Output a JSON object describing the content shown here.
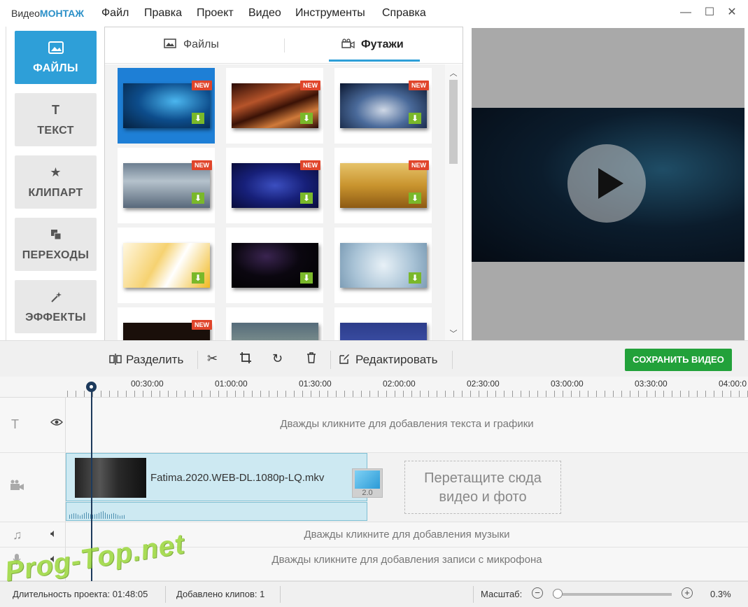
{
  "app": {
    "logo_part1": "Видео",
    "logo_part2": "МОНТАЖ"
  },
  "menu": [
    "Файл",
    "Правка",
    "Проект",
    "Видео",
    "Инструменты",
    "Справка"
  ],
  "categories": [
    {
      "label": "ФАЙЛЫ",
      "icon": "image-icon",
      "active": true
    },
    {
      "label": "ТЕКСТ",
      "icon": "text-icon"
    },
    {
      "label": "КЛИПАРТ",
      "icon": "star-icon"
    },
    {
      "label": "ПЕРЕХОДЫ",
      "icon": "transitions-icon"
    },
    {
      "label": "ЭФФЕКТЫ",
      "icon": "magic-wand-icon"
    }
  ],
  "library": {
    "tabs": [
      {
        "label": "Файлы",
        "icon": "image-icon"
      },
      {
        "label": "Футажи",
        "icon": "film-camera-icon",
        "active": true
      }
    ],
    "badge": "NEW"
  },
  "toolbar": {
    "split": "Разделить",
    "edit": "Редактировать",
    "save": "СОХРАНИТЬ ВИДЕО"
  },
  "ruler": [
    "00:30:00",
    "01:00:00",
    "01:30:00",
    "02:00:00",
    "02:30:00",
    "03:00:00",
    "03:30:00",
    "04:00:0"
  ],
  "tracks": {
    "text_hint": "Дважды кликните для добавления текста и графики",
    "music_hint": "Дважды кликните для добавления музыки",
    "mic_hint": "Дважды кликните для добавления записи с микрофона",
    "clip_name": "Fatima.2020.WEB-DL.1080p-LQ.mkv",
    "transition_value": "2.0",
    "drop_line1": "Перетащите сюда",
    "drop_line2": "видео и фото"
  },
  "status": {
    "duration_label": "Длительность проекта:",
    "duration_value": "01:48:05",
    "clips_label": "Добавлено клипов:",
    "clips_value": "1",
    "zoom_label": "Масштаб:",
    "zoom_value": "0.3%"
  },
  "watermark": "Prog-Top.net",
  "colors": {
    "accent": "#2e9fd8",
    "save": "#22a13a",
    "new_badge": "#e0452b"
  }
}
